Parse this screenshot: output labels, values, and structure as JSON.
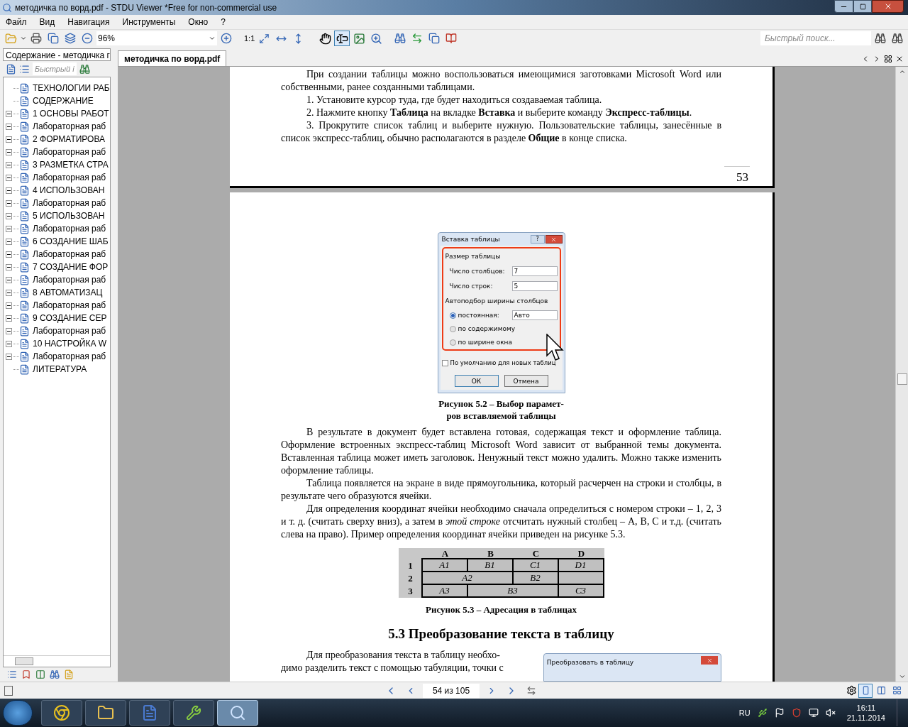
{
  "window": {
    "title": "методичка по ворд.pdf - STDU Viewer *Free for non-commercial use"
  },
  "menu": [
    "Файл",
    "Вид",
    "Навигация",
    "Инструменты",
    "Окно",
    "?"
  ],
  "toolbar": {
    "zoom": "96%",
    "actual_size": "1:1",
    "search_placeholder": "Быстрый поиск...",
    "tools": [
      {
        "kind": "hand",
        "pressed": false
      },
      {
        "kind": "text",
        "pressed": true
      },
      {
        "kind": "image",
        "pressed": false
      },
      {
        "kind": "zoom",
        "pressed": false
      }
    ]
  },
  "sidebar": {
    "tab": "Содержание - методичка г",
    "search_placeholder": "Быстрый і",
    "tree": [
      {
        "label": "ТЕХНОЛОГИИ РАБ",
        "kind": "leaf"
      },
      {
        "label": "СОДЕРЖАНИЕ",
        "kind": "leaf"
      },
      {
        "label": "1 ОСНОВЫ РАБОТ",
        "kind": "branch"
      },
      {
        "label": "Лабораторная раб",
        "kind": "branch"
      },
      {
        "label": "2 ФОРМАТИРОВА",
        "kind": "branch"
      },
      {
        "label": "Лабораторная раб",
        "kind": "branch"
      },
      {
        "label": "3 РАЗМЕТКА СТРА",
        "kind": "branch"
      },
      {
        "label": "Лабораторная раб",
        "kind": "branch"
      },
      {
        "label": "4 ИСПОЛЬЗОВАН",
        "kind": "branch"
      },
      {
        "label": "Лабораторная раб",
        "kind": "branch"
      },
      {
        "label": "5 ИСПОЛЬЗОВАН",
        "kind": "branch"
      },
      {
        "label": "Лабораторная раб",
        "kind": "branch"
      },
      {
        "label": "6 СОЗДАНИЕ ШАБ",
        "kind": "branch"
      },
      {
        "label": "Лабораторная раб",
        "kind": "branch"
      },
      {
        "label": "7 СОЗДАНИЕ ФОР",
        "kind": "branch"
      },
      {
        "label": "Лабораторная раб",
        "kind": "branch"
      },
      {
        "label": "8 АВТОМАТИЗАЦ",
        "kind": "branch"
      },
      {
        "label": "Лабораторная раб",
        "kind": "branch"
      },
      {
        "label": "9 СОЗДАНИЕ СЕР",
        "kind": "branch"
      },
      {
        "label": "Лабораторная раб",
        "kind": "branch"
      },
      {
        "label": "10 НАСТРОЙКА W",
        "kind": "branch"
      },
      {
        "label": "Лабораторная раб",
        "kind": "branch"
      },
      {
        "label": "ЛИТЕРАТУРА",
        "kind": "leaf"
      }
    ]
  },
  "document": {
    "tab": "методичка по ворд.pdf",
    "page_1": {
      "paragraphs": [
        {
          "kind": "text",
          "text": "При создании таблицы можно воспользоваться имеющимися заготовками Microsoft Word или собственными, ранее созданными таблицами."
        },
        {
          "kind": "list",
          "text": "1. Установите курсор туда, где будет находиться создаваемая таблица."
        },
        {
          "kind": "list",
          "text": "2. Нажмите кнопку **Таблица** на вкладке **Вставка** и выберите команду **Экспресс-таблицы**."
        },
        {
          "kind": "text",
          "text": "3. Прокрутите список таблиц и выберите нужную. Пользовательские таблицы, занесённые в список экспресс-таблиц, обычно располагаются в разделе **Общие** в конце списка."
        }
      ],
      "page_number": "53"
    },
    "page_2": {
      "dialog": {
        "title": "Вставка таблицы",
        "help": "?",
        "group_1": "Размер таблицы",
        "fields": [
          {
            "label": "Число столбцов:",
            "value": "7"
          },
          {
            "label": "Число строк:",
            "value": "5"
          }
        ],
        "group_2": "Автоподбор ширины столбцов",
        "radios": [
          {
            "label": "постоянная:",
            "selected": true,
            "value": "Авто"
          },
          {
            "label": "по содержимому",
            "selected": false
          },
          {
            "label": "по ширине окна",
            "selected": false
          }
        ],
        "checkbox": {
          "label": "По умолчанию для новых таблиц",
          "checked": false
        },
        "buttons": [
          "ОК",
          "Отмена"
        ]
      },
      "caption_1": [
        "Рисунок 5.2 – Выбор парамет-",
        "ров вставляемой таблицы"
      ],
      "paragraphs": [
        "В результате в документ будет вставлена готовая, содержащая текст и оформление таблица. Оформление встроенных экспресс-таблиц Microsoft Word зависит от выбранной темы документа. Вставленная таблица может иметь заголовок. Ненужный текст можно удалить. Можно также изменить оформление таблицы.",
        "Таблица появляется на экране в виде прямоугольника, который расчерчен на строки и столбцы, в результате чего образуются ячейки.",
        "Для определения координат ячейки необходимо сначала определиться с номером строки – 1, 2, 3 и т. д. (считать сверху вниз), а затем в *этой строке* отсчитать нужный столбец – A, B, C и т.д. (считать слева на право). Пример определения координат ячейки приведен на рисунке 5.3."
      ],
      "table": {
        "columns": [
          "A",
          "B",
          "C",
          "D"
        ],
        "rows": [
          {
            "label": "1",
            "cells": [
              {
                "text": "A1",
                "kind": "single"
              },
              {
                "text": "B1",
                "kind": "single"
              },
              {
                "text": "C1",
                "kind": "single"
              },
              {
                "text": "D1",
                "kind": "single"
              }
            ]
          },
          {
            "label": "2",
            "cells": [
              {
                "text": "A2",
                "kind": "wide"
              },
              {
                "text": "",
                "kind": "covered"
              },
              {
                "text": "B2",
                "kind": "single"
              },
              {
                "text": "",
                "kind": "single"
              }
            ]
          },
          {
            "label": "3",
            "cells": [
              {
                "text": "A3",
                "kind": "single"
              },
              {
                "text": "B3",
                "kind": "wide"
              },
              {
                "text": "",
                "kind": "covered"
              },
              {
                "text": "C3",
                "kind": "single"
              }
            ]
          }
        ]
      },
      "caption_2": "Рисунок 5.3 – Адресация в таблицах",
      "heading": "5.3 Преобразование текста в таблицу",
      "last_lines": [
        "Для преобразования текста в таблицу необхо-",
        "димо разделить текст с помощью табуляции, точки с"
      ],
      "dialog_2": {
        "title": "Преобразовать в таблицу"
      }
    }
  },
  "status_bar": {
    "page": "54 из 105",
    "view_modes": [
      {
        "kind": "single",
        "selected": true
      },
      {
        "kind": "double",
        "selected": false
      },
      {
        "kind": "grid",
        "selected": false
      }
    ]
  },
  "taskbar": {
    "apps": [
      {
        "kind": "chrome",
        "selected": false
      },
      {
        "kind": "folder",
        "selected": false
      },
      {
        "kind": "word",
        "selected": false
      },
      {
        "kind": "tool",
        "selected": false
      },
      {
        "kind": "viewer",
        "selected": true
      }
    ],
    "language": "RU",
    "time": "16:11",
    "date": "21.11.2014"
  }
}
